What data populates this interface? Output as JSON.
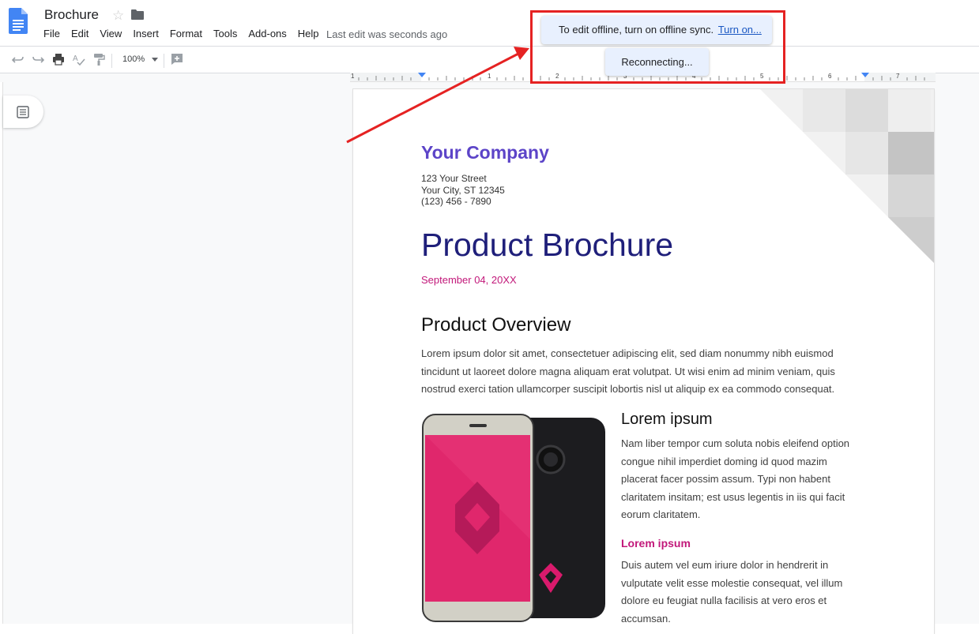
{
  "header": {
    "title": "Brochure",
    "last_edit": "Last edit was seconds ago",
    "menu": [
      "File",
      "Edit",
      "View",
      "Insert",
      "Format",
      "Tools",
      "Add-ons",
      "Help"
    ]
  },
  "toolbar": {
    "zoom": "100%"
  },
  "ruler": {
    "numbers": [
      "1",
      "1",
      "2",
      "3",
      "4",
      "5",
      "6",
      "7"
    ]
  },
  "toast": {
    "message": "To edit offline, turn on offline sync.",
    "link": "Turn on...",
    "reconnecting": "Reconnecting..."
  },
  "document": {
    "company": "Your Company",
    "address": [
      "123 Your Street",
      "Your City, ST 12345",
      "(123) 456 - 7890"
    ],
    "title": "Product Brochure",
    "date": "September 04, 20XX",
    "overview_heading": "Product Overview",
    "overview_text": "Lorem ipsum dolor sit amet, consectetuer adipiscing elit, sed diam nonummy nibh euismod tincidunt ut laoreet dolore magna aliquam erat volutpat. Ut wisi enim ad minim veniam, quis nostrud exerci tation ullamcorper suscipit lobortis nisl ut aliquip ex ea commodo consequat.",
    "section_heading": "Lorem ipsum",
    "section_text": "Nam liber tempor cum soluta nobis eleifend option congue nihil imperdiet doming id quod mazim placerat facer possim assum. Typi non habent claritatem insitam; est usus legentis in iis qui facit eorum claritatem.",
    "subheading": "Lorem ipsum",
    "sub_text": "Duis autem vel eum iriure dolor in hendrerit in vulputate velit esse molestie consequat, vel illum dolore eu feugiat nulla facilisis at vero eros et accumsan."
  },
  "colors": {
    "accent_purple": "#5c44c8",
    "title_navy": "#1f1f7a",
    "accent_magenta": "#c2187a",
    "highlight_red": "#e52222",
    "toast_bg": "#e8f0fe"
  }
}
